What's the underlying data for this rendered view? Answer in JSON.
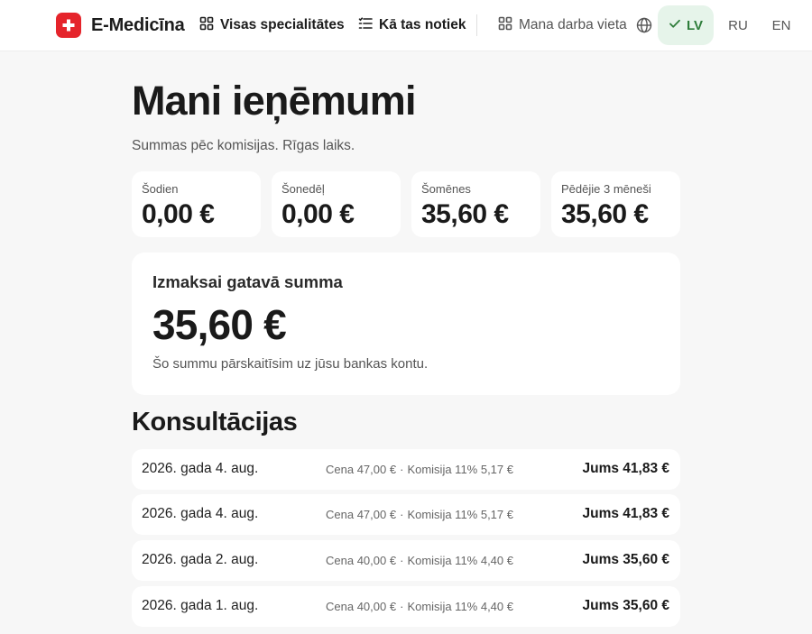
{
  "header": {
    "brand": "E-Medicīna",
    "nav": [
      {
        "label": "Visas specialitātes"
      },
      {
        "label": "Kā tas notiek"
      },
      {
        "label": "Mana darba vieta"
      }
    ],
    "languages": [
      {
        "label": "LV",
        "active": true
      },
      {
        "label": "RU",
        "active": false
      },
      {
        "label": "EN",
        "active": false
      }
    ]
  },
  "page": {
    "title": "Mani ieņēmumi",
    "subtitle": "Summas pēc komisijas. Rīgas laiks."
  },
  "stats": [
    {
      "label": "Šodien",
      "value": "0,00 €"
    },
    {
      "label": "Šonedēļ",
      "value": "0,00 €"
    },
    {
      "label": "Šomēnes",
      "value": "35,60 €"
    },
    {
      "label": "Pēdējie 3 mēneši",
      "value": "35,60 €"
    }
  ],
  "payout": {
    "title": "Izmaksai gatavā summa",
    "amount": "35,60 €",
    "note": "Šo summu pārskaitīsim uz jūsu bankas kontu."
  },
  "consultations": {
    "title": "Konsultācijas",
    "rows": [
      {
        "date": "2026. gada 4. aug.",
        "price": "Cena 47,00 €",
        "commission": "Komisija 11% 5,17 €",
        "total": "Jums 41,83 €"
      },
      {
        "date": "2026. gada 4. aug.",
        "price": "Cena 47,00 €",
        "commission": "Komisija 11% 5,17 €",
        "total": "Jums 41,83 €"
      },
      {
        "date": "2026. gada 2. aug.",
        "price": "Cena 40,00 €",
        "commission": "Komisija 11% 4,40 €",
        "total": "Jums 35,60 €"
      },
      {
        "date": "2026. gada 1. aug.",
        "price": "Cena 40,00 €",
        "commission": "Komisija 11% 4,40 €",
        "total": "Jums 35,60 €"
      }
    ]
  },
  "colors": {
    "brand": "#e5242b",
    "active_lang_bg": "#e6f4ea",
    "active_lang_text": "#2e7d3a",
    "background": "#f7f7f7"
  },
  "icons": [
    "cross-logo-icon",
    "grid-icon",
    "list-icon",
    "grid-icon",
    "globe-icon",
    "check-icon"
  ]
}
